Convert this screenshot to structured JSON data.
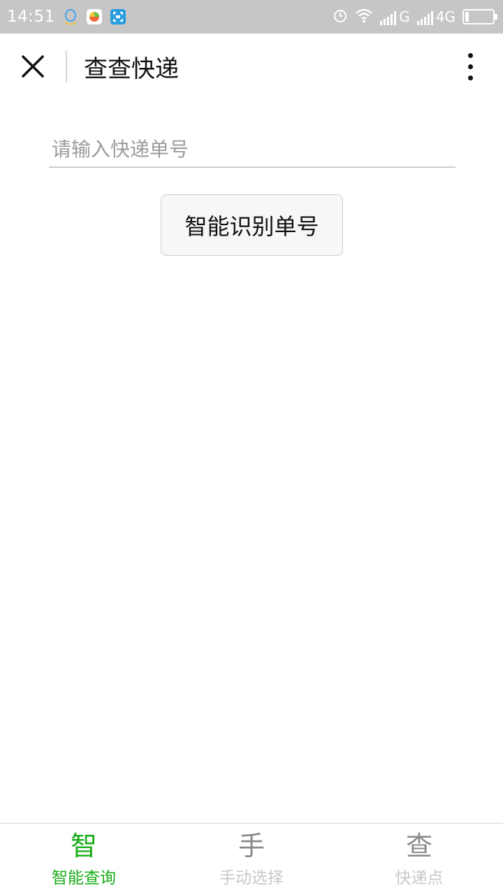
{
  "status_bar": {
    "time": "14:51",
    "network1": "G",
    "network2": "4G",
    "icons": [
      "qq-icon",
      "gallery-app-icon",
      "scan-app-icon",
      "alarm-icon",
      "wifi-icon",
      "signal-icon",
      "battery-icon"
    ]
  },
  "header": {
    "title": "查查快递"
  },
  "search": {
    "placeholder": "请输入快递单号",
    "value": ""
  },
  "recognize_button": {
    "label": "智能识别单号"
  },
  "tabs": [
    {
      "icon_char": "智",
      "label": "智能查询",
      "active": true
    },
    {
      "icon_char": "手",
      "label": "手动选择",
      "active": false
    },
    {
      "icon_char": "查",
      "label": "快递点",
      "active": false
    }
  ],
  "colors": {
    "accent": "#1aad19",
    "status_bar": "#c6c6c6",
    "inactive_label": "#c8c8c8"
  }
}
